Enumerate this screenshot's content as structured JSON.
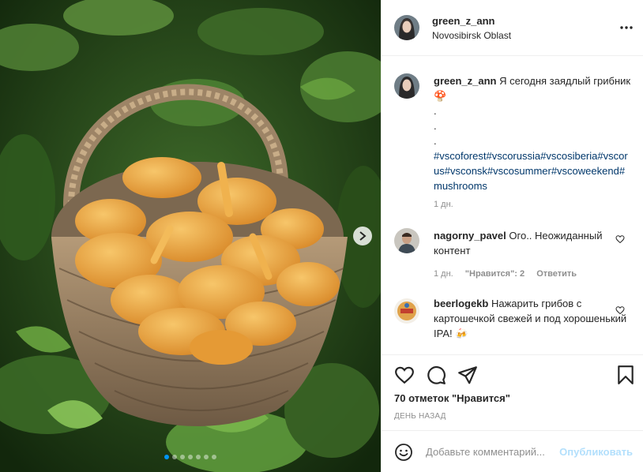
{
  "post": {
    "image_alt": "",
    "carousel": {
      "slide_count": 7,
      "active_index": 0
    }
  },
  "header": {
    "username": "green_z_ann",
    "location": "Novosibirsk Oblast",
    "more_icon": "more-horizontal-icon"
  },
  "caption": {
    "username": "green_z_ann",
    "text": "Я сегодня заядлый грибник",
    "emoji": "🍄",
    "lines": [
      ".",
      ".",
      "."
    ],
    "hashtags": "#vscoforest#vscorussia#vscosiberia#vscorus#vsconsk#vscosummer#vscoweekend#mushrooms",
    "time": "1 дн."
  },
  "comments": [
    {
      "username": "nagorny_pavel",
      "text": "Ого.. Неожиданный контент",
      "time": "1 дн.",
      "likes_label": "\"Нравится\": 2",
      "reply_label": "Ответить"
    },
    {
      "username": "beerlogekb",
      "text": "Нажарить грибов с картошечкой свежей и под хорошенький IPA!",
      "emoji": "🍻"
    }
  ],
  "actions": {
    "icons": [
      "heart-icon",
      "comment-icon",
      "share-icon",
      "bookmark-icon"
    ],
    "likes_text": "70 отметок \"Нравится\"",
    "date_text": "ДЕНЬ НАЗАД"
  },
  "composer": {
    "placeholder": "Добавьте комментарий...",
    "publish_label": "Опубликовать",
    "emoji_icon": "smiley-icon"
  },
  "colors": {
    "link": "#00376b",
    "accent": "#0095f6",
    "publish_disabled": "#b2dffc",
    "muted": "#8e8e8e",
    "border": "#efefef"
  }
}
